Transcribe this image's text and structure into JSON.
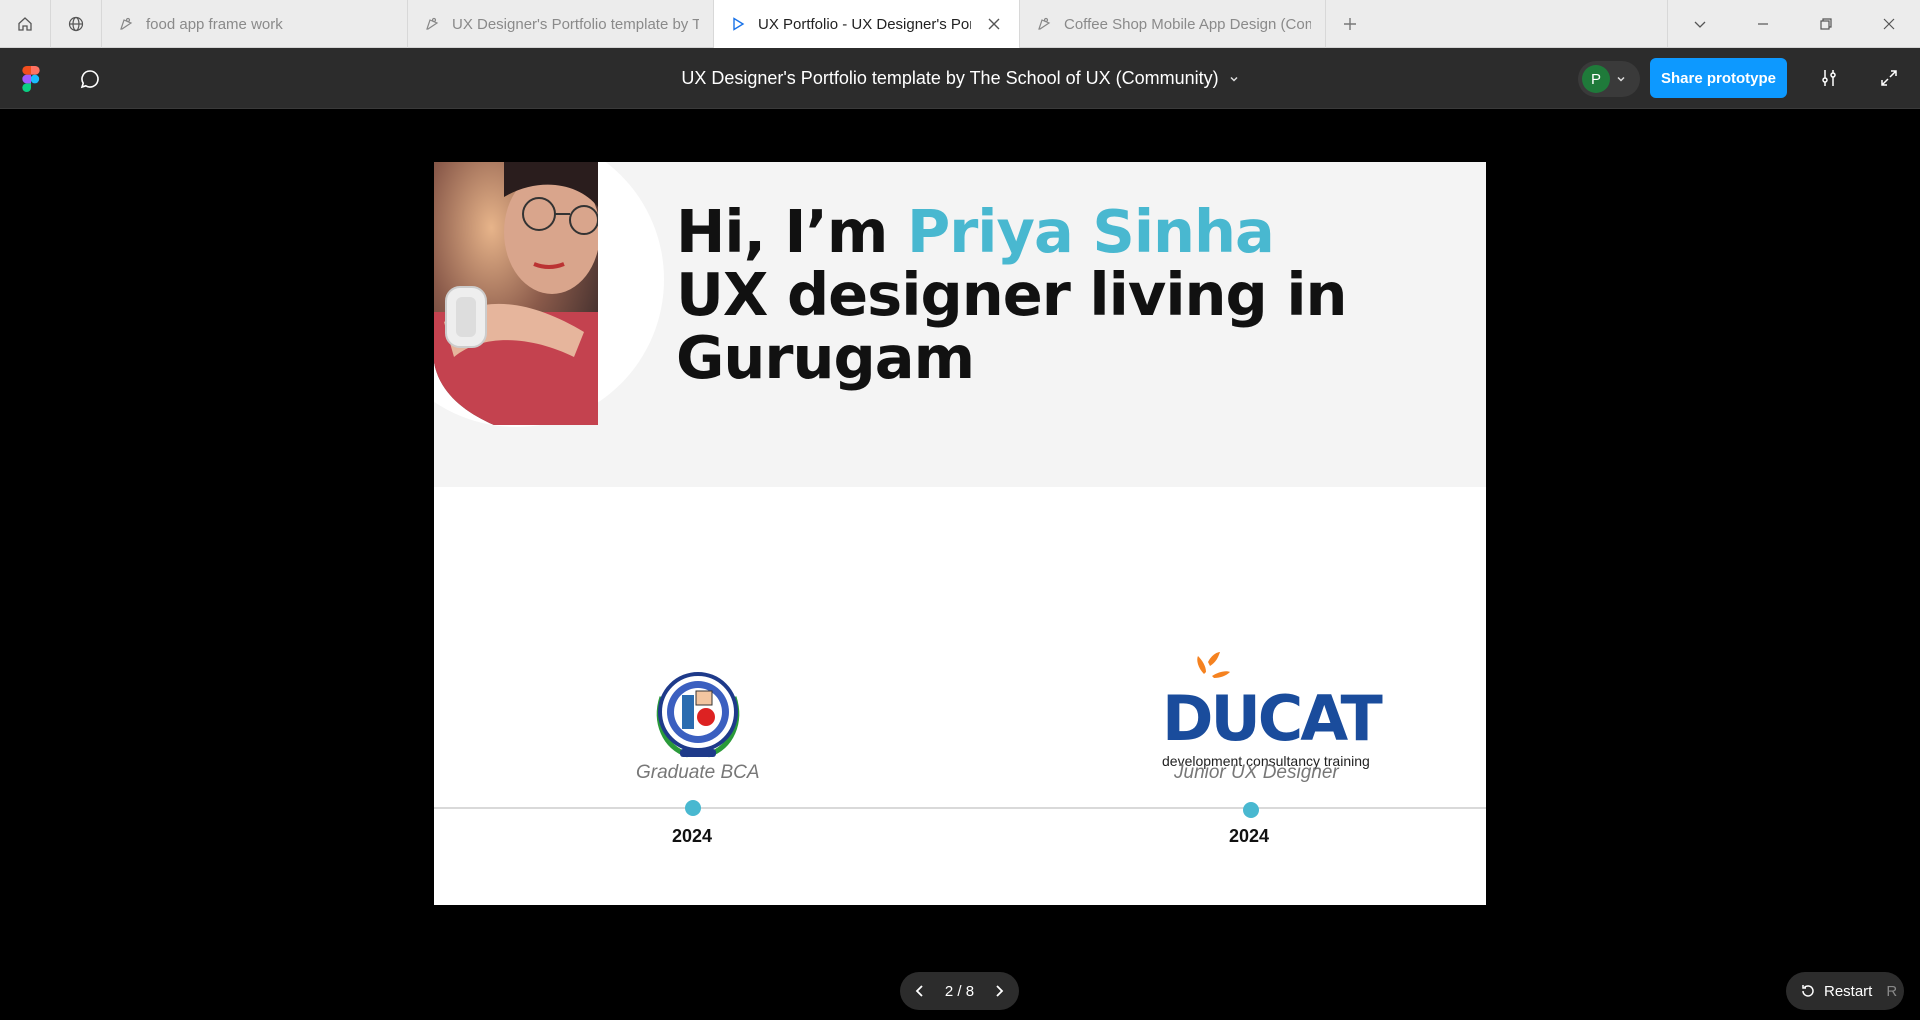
{
  "browser": {
    "tabs": [
      {
        "title": "food app frame work",
        "active": false
      },
      {
        "title": "UX Designer's Portfolio template by T",
        "active": false
      },
      {
        "title": "UX Portfolio - UX Designer's Port",
        "active": true
      },
      {
        "title": "Coffee Shop Mobile App Design (Com",
        "active": false
      }
    ]
  },
  "toolbar": {
    "file_title": "UX Designer's Portfolio template by The School of UX (Community)",
    "avatar_initial": "P",
    "share_label": "Share prototype"
  },
  "hero": {
    "greeting": "Hi, I’m ",
    "name": "Priya Sinha",
    "line2": "UX designer living in",
    "line3": "Gurugam"
  },
  "timeline": [
    {
      "caption": "Graduate BCA",
      "year": "2024",
      "logo": "university-seal"
    },
    {
      "caption": "Junior UX Designer",
      "year": "2024",
      "logo": "ducat-logo"
    }
  ],
  "ducat_logo": {
    "wordmark": "DUCAT",
    "tagline": "development  consultancy  training"
  },
  "pager": {
    "label": "2 / 8"
  },
  "restart": {
    "label": "Restart",
    "shortcut": "R"
  },
  "colors": {
    "accent": "#49b8d0",
    "share_button": "#0d99ff",
    "toolbar": "#2c2c2c"
  }
}
